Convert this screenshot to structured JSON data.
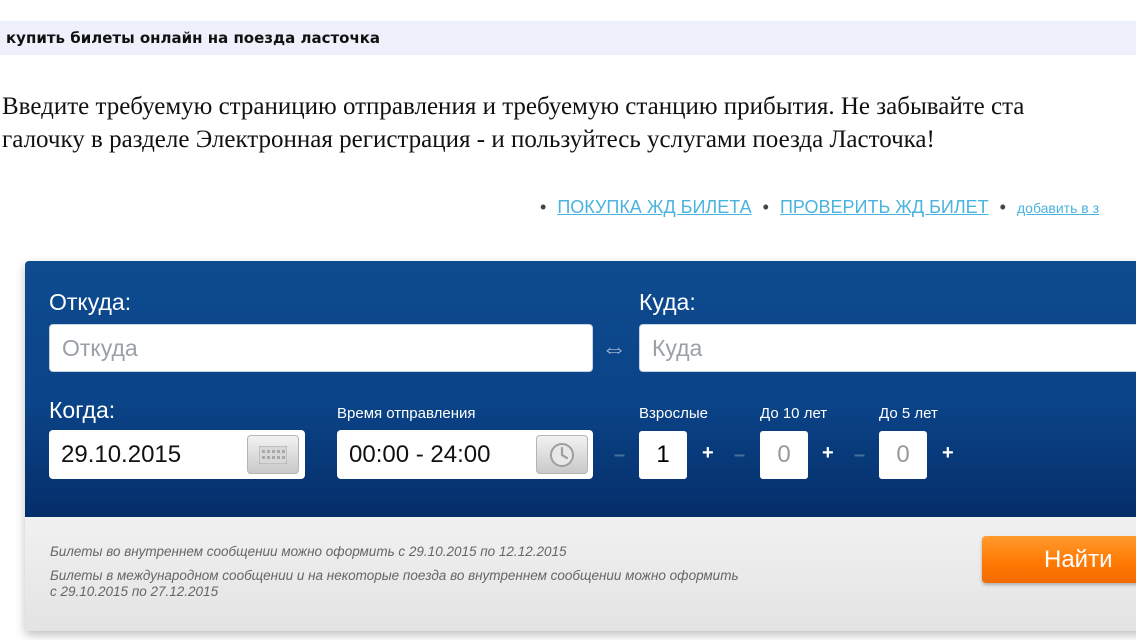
{
  "header": {
    "title": "купить билеты онлайн на поезда ласточка"
  },
  "intro": {
    "line1": "Введите требуемую страницию отправления и требуемую станцию прибытия. Не забывайте ста",
    "line2": "галочку в разделе Электронная регистрация - и пользуйтесь услугами поезда Ласточка!"
  },
  "links": [
    {
      "label": "ПОКУПКА ЖД БИЛЕТА"
    },
    {
      "label": "ПРОВЕРИТЬ ЖД БИЛЕТ"
    },
    {
      "label": "добавить в з"
    }
  ],
  "form": {
    "from": {
      "label": "Откуда:",
      "placeholder": "Откуда"
    },
    "to": {
      "label": "Куда:",
      "placeholder": "Куда"
    },
    "swap_icon": "swap-arrows-icon",
    "when": {
      "label": "Когда:",
      "value": "29.10.2015",
      "icon": "calendar-icon"
    },
    "time": {
      "label": "Время отправления",
      "value": "00:00 - 24:00",
      "icon": "clock-icon"
    },
    "passengers": [
      {
        "label": "Взрослые",
        "value": "1",
        "minus": "–",
        "plus": "+"
      },
      {
        "label": "До 10 лет",
        "value": "0",
        "minus": "–",
        "plus": "+"
      },
      {
        "label": "До 5 лет",
        "value": "0",
        "minus": "–",
        "plus": "+"
      }
    ]
  },
  "notes": {
    "domestic": "Билеты во внутреннем сообщении можно оформить с 29.10.2015 по 12.12.2015",
    "international_line1": "Билеты в международном сообщении и на некоторые поезда во внутреннем сообщении можно оформить",
    "international_line2": "с 29.10.2015 по 27.12.2015"
  },
  "search_button": {
    "label": "Найти"
  },
  "colors": {
    "panel_blue": "#0b4488",
    "link": "#4ab3df",
    "button_orange": "#ff7a05"
  }
}
